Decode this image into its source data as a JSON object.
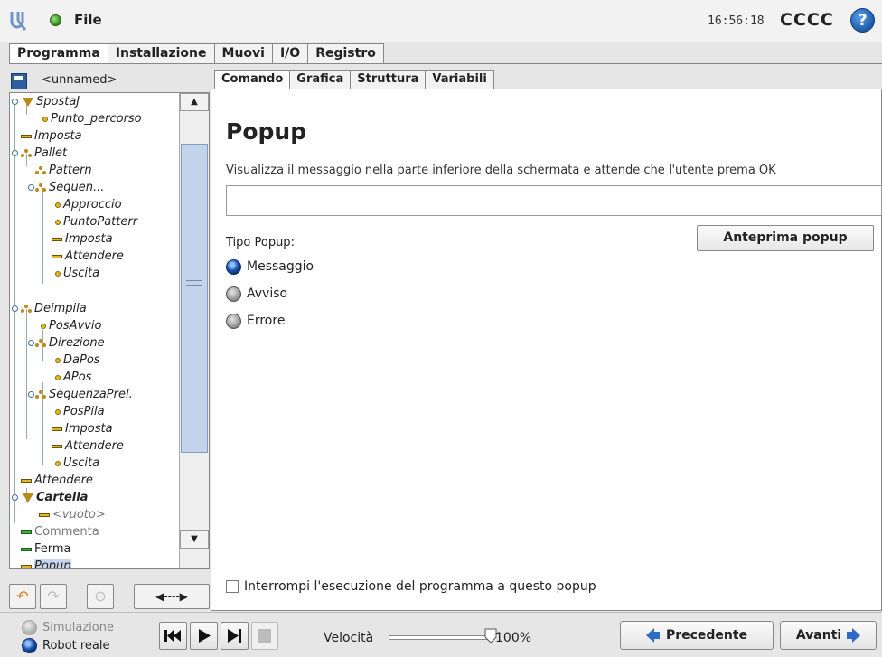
{
  "header": {
    "file_label": "File",
    "time": "16:56:18",
    "robot_name": "CCCC",
    "help": "?"
  },
  "main_tabs": [
    "Programma",
    "Installazione",
    "Muovi",
    "I/O",
    "Registro"
  ],
  "program": {
    "name": "<unnamed>",
    "tree": [
      "SpostaJ",
      "Punto_percorso",
      "Imposta",
      "Pallet",
      "Pattern",
      "Sequen...",
      "Approccio",
      "PuntoPatterr",
      "Imposta",
      "Attendere",
      "Uscita",
      "Deimpila",
      "PosAvvio",
      "Direzione",
      "DaPos",
      "APos",
      "SequenzaPrel.",
      "PosPila",
      "Imposta",
      "Attendere",
      "Uscita",
      "Attendere",
      "Cartella",
      "<vuoto>",
      "Commenta",
      "Ferma",
      "Popup"
    ]
  },
  "sub_tabs": [
    "Comando",
    "Grafica",
    "Struttura",
    "Variabili"
  ],
  "popup": {
    "title": "Popup",
    "description": "Visualizza il messaggio nella parte inferiore della schermata e attende che l'utente prema OK",
    "message_value": "",
    "preview_button": "Anteprima popup",
    "type_label": "Tipo Popup:",
    "types": [
      "Messaggio",
      "Avviso",
      "Errore"
    ],
    "selected_type": "Messaggio",
    "stop_checkbox": "Interrompi l'esecuzione del programma a questo popup",
    "stop_checked": false
  },
  "bottom": {
    "modes": [
      "Simulazione",
      "Robot reale"
    ],
    "selected_mode": "Robot reale",
    "speed_label": "Velocità",
    "speed_value": "100%",
    "speed_fraction": 1.0,
    "prev_button": "Precedente",
    "next_button": "Avanti"
  },
  "colors": {
    "accent_blue": "#2d6bc4",
    "selection": "#c7d5ee",
    "waypoint": "#e0b62a"
  }
}
